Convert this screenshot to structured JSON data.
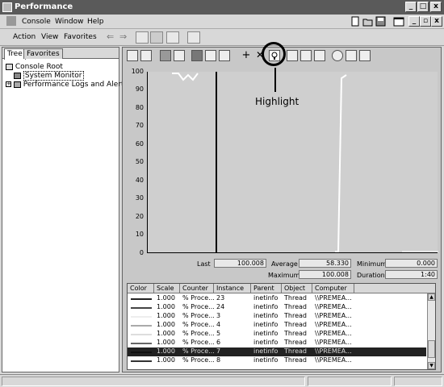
{
  "window": {
    "title": "Performance",
    "min": "_",
    "max": "□",
    "close": "x"
  },
  "menubar": {
    "console": "Console",
    "window": "Window",
    "help": "Help"
  },
  "toolbar2": {
    "action": "Action",
    "view": "View",
    "favorites": "Favorites"
  },
  "tree": {
    "tabs": [
      "Tree",
      "Favorites"
    ],
    "items": [
      {
        "label": "Console Root"
      },
      {
        "label": "System Monitor"
      },
      {
        "label": "Performance Logs and Alerts"
      }
    ]
  },
  "graph": {
    "yticks": [
      "100",
      "90",
      "80",
      "70",
      "60",
      "50",
      "40",
      "30",
      "20",
      "10",
      "0"
    ],
    "callout": "Highlight"
  },
  "stats": {
    "last_label": "Last",
    "last_value": "100.008",
    "average_label": "Average",
    "average_value": "58.330",
    "minimum_label": "Minimum",
    "minimum_value": "0.000",
    "maximum_label": "Maximum",
    "maximum_value": "100.008",
    "duration_label": "Duration",
    "duration_value": "1:40"
  },
  "counters": {
    "headers": [
      "Color",
      "Scale",
      "Counter",
      "Instance",
      "Parent",
      "Object",
      "Computer"
    ],
    "rows": [
      {
        "scale": "1.000",
        "counter": "% Proce...",
        "instance": "23",
        "parent": "inetinfo",
        "object": "Thread",
        "computer": "\\\\PREMEA..."
      },
      {
        "scale": "1.000",
        "counter": "% Proce...",
        "instance": "24",
        "parent": "inetinfo",
        "object": "Thread",
        "computer": "\\\\PREMEA..."
      },
      {
        "scale": "1.000",
        "counter": "% Proce...",
        "instance": "3",
        "parent": "inetinfo",
        "object": "Thread",
        "computer": "\\\\PREMEA..."
      },
      {
        "scale": "1.000",
        "counter": "% Proce...",
        "instance": "4",
        "parent": "inetinfo",
        "object": "Thread",
        "computer": "\\\\PREMEA..."
      },
      {
        "scale": "1.000",
        "counter": "% Proce...",
        "instance": "5",
        "parent": "inetinfo",
        "object": "Thread",
        "computer": "\\\\PREMEA..."
      },
      {
        "scale": "1.000",
        "counter": "% Proce...",
        "instance": "6",
        "parent": "inetinfo",
        "object": "Thread",
        "computer": "\\\\PREMEA..."
      },
      {
        "scale": "1.000",
        "counter": "% Proce...",
        "instance": "7",
        "parent": "inetinfo",
        "object": "Thread",
        "computer": "\\\\PREMEA..."
      },
      {
        "scale": "1.000",
        "counter": "% Proce...",
        "instance": "8",
        "parent": "inetinfo",
        "object": "Thread",
        "computer": "\\\\PREMEA..."
      }
    ],
    "selected_index": 6
  }
}
